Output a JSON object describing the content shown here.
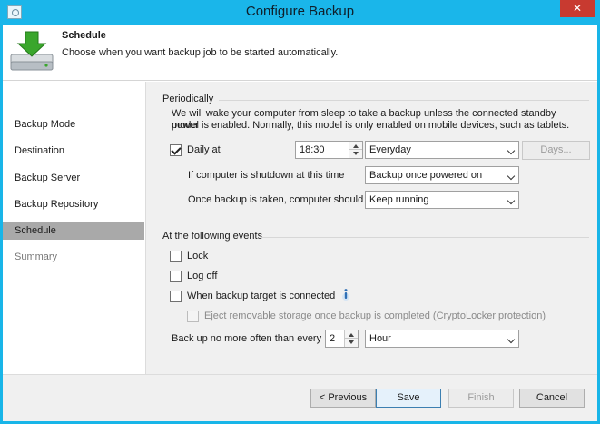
{
  "window": {
    "title": "Configure Backup",
    "close_label": "✕"
  },
  "header": {
    "title": "Schedule",
    "description": "Choose when you want backup job to be started automatically."
  },
  "sidebar": {
    "items": [
      {
        "label": "Backup Mode"
      },
      {
        "label": "Destination"
      },
      {
        "label": "Backup Server"
      },
      {
        "label": "Backup Repository"
      },
      {
        "label": "Schedule"
      },
      {
        "label": "Summary"
      }
    ]
  },
  "periodically": {
    "title": "Periodically",
    "line1": "We will wake your computer from sleep to take a backup unless the connected standby power",
    "line2": "model is enabled. Normally, this model is only enabled on mobile devices, such as tablets.",
    "daily_label": "Daily at",
    "daily_checked": true,
    "time_value": "18:30",
    "frequency_value": "Everyday",
    "days_button": "Days...",
    "shutdown_label": "If computer is shutdown at this time",
    "shutdown_value": "Backup once powered on",
    "after_label": "Once backup is taken, computer should",
    "after_value": "Keep running"
  },
  "events": {
    "title": "At the following events",
    "lock_label": "Lock",
    "logoff_label": "Log off",
    "target_label": "When backup target is connected",
    "eject_label": "Eject removable storage once backup is completed (CryptoLocker protection)",
    "limit_label": "Back up no more often than every",
    "limit_value": "2",
    "limit_unit": "Hour"
  },
  "footer": {
    "previous": "< Previous",
    "save": "Save",
    "finish": "Finish",
    "cancel": "Cancel"
  },
  "colors": {
    "titlebar": "#1ab6ea",
    "close": "#c83a30",
    "active_item": "#a9a9a9",
    "icon_green": "#3aa62c"
  }
}
